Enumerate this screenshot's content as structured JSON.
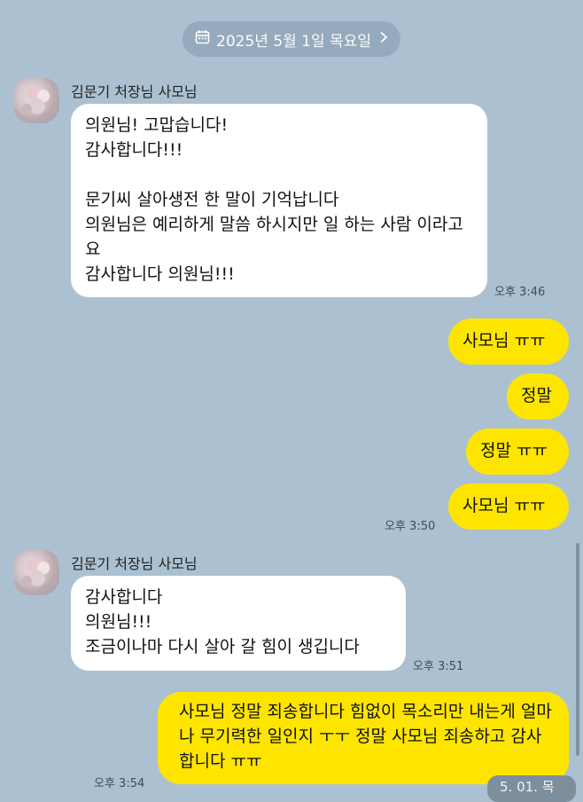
{
  "header": {
    "date_label": "2025년 5월 1일 목요일",
    "calendar_icon": "calendar-icon",
    "chevron_icon": "chevron-right-icon"
  },
  "colors": {
    "background": "#abc1d1",
    "incoming_bubble": "#ffffff",
    "outgoing_bubble": "#fee500",
    "date_pill": "#95aabc"
  },
  "messages": [
    {
      "sender": "김문기 처장님 사모님",
      "text": "의원님! 고맙습니다!\n감사합니다!!!\n\n문기씨 살아생전 한 말이 기억납니다\n의원님은 예리하게 말씀 하시지만 일 하는 사람 이라고요\n감사합니다 의원님!!!",
      "time": "오후 3:46"
    },
    {
      "text": "사모님 ㅠㅠ"
    },
    {
      "text": "정말"
    },
    {
      "text": "정말 ㅠㅠ"
    },
    {
      "text": "사모님 ㅠㅠ",
      "time": "오후 3:50"
    },
    {
      "sender": "김문기 처장님 사모님",
      "text": "감사합니다\n의원님!!!\n조금이나마 다시 살아 갈 힘이 생깁니다",
      "time": "오후 3:51"
    },
    {
      "text": "사모님 정말 죄송합니다 힘없이 목소리만 내는게 얼마나 무기력한 일인지 ㅜㅜ 정말 사모님 죄송하고 감사합니다 ㅠㅠ",
      "time": "오후 3:54"
    }
  ],
  "footer": {
    "date_badge": "5. 01. 목"
  }
}
